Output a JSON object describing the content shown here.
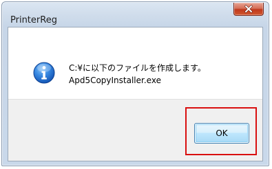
{
  "window": {
    "title": "PrinterReg"
  },
  "dialog": {
    "icon": "info-icon",
    "message_line1": "C:¥に以下のファイルを作成します。",
    "message_line2": "Apd5CopyInstaller.exe"
  },
  "buttons": {
    "ok_label": "OK",
    "close_icon": "close-icon"
  },
  "colors": {
    "highlight_border": "#d90f0f",
    "close_button": "#c7402a",
    "info_icon": "#1f6fd0"
  }
}
